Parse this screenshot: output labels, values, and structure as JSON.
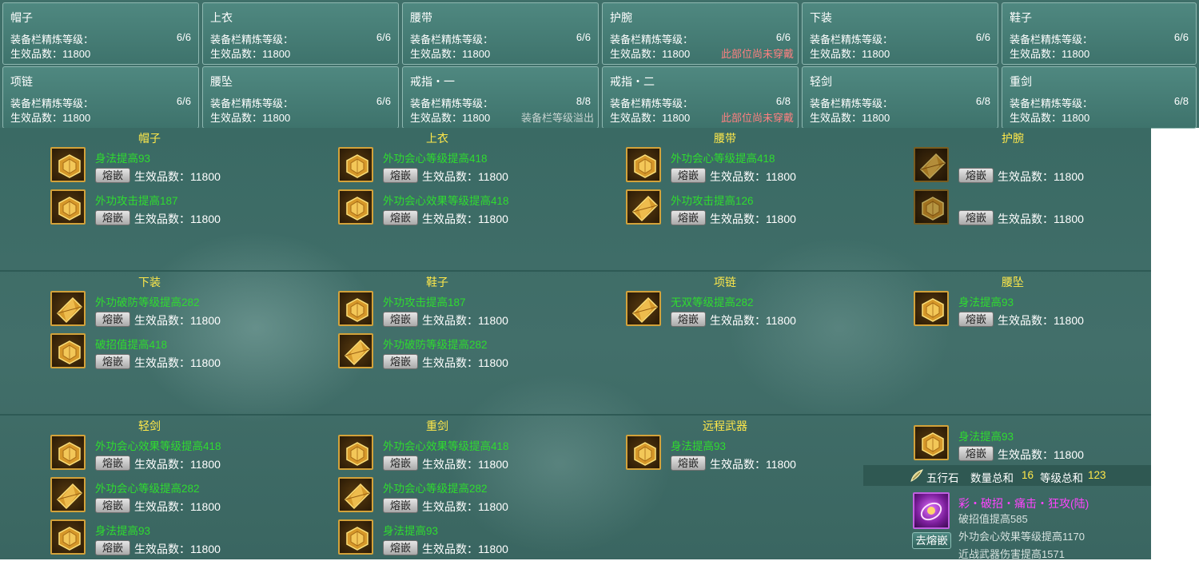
{
  "summary": {
    "refine_label": "装备栏精炼等级：",
    "count_label": "生效品数：11800",
    "cards": [
      {
        "name": "帽子",
        "level": "6/6",
        "note": "",
        "note_color": ""
      },
      {
        "name": "上衣",
        "level": "6/6",
        "note": "",
        "note_color": ""
      },
      {
        "name": "腰带",
        "level": "6/6",
        "note": "",
        "note_color": ""
      },
      {
        "name": "护腕",
        "level": "6/6",
        "note": "此部位尚未穿戴",
        "note_color": "#ff8080"
      },
      {
        "name": "下装",
        "level": "6/6",
        "note": "",
        "note_color": ""
      },
      {
        "name": "鞋子",
        "level": "6/6",
        "note": "",
        "note_color": ""
      },
      {
        "name": "项链",
        "level": "6/6",
        "note": "",
        "note_color": ""
      },
      {
        "name": "腰坠",
        "level": "6/6",
        "note": "",
        "note_color": ""
      },
      {
        "name": "戒指・一",
        "level": "8/8",
        "note": "装备栏等级溢出",
        "note_color": "#c7d3d0"
      },
      {
        "name": "戒指・二",
        "level": "6/8",
        "note": "此部位尚未穿戴",
        "note_color": "#ff8080"
      },
      {
        "name": "轻剑",
        "level": "6/8",
        "note": "",
        "note_color": ""
      },
      {
        "name": "重剑",
        "level": "6/8",
        "note": "",
        "note_color": ""
      }
    ]
  },
  "gems": {
    "melt_label": "熔嵌",
    "count_label": "生效品数：11800",
    "panels": [
      {
        "title": "帽子",
        "slots": [
          {
            "text": "身法提高93",
            "shape": "round"
          },
          {
            "text": "外功攻击提高187",
            "shape": "round"
          }
        ]
      },
      {
        "title": "上衣",
        "slots": [
          {
            "text": "外功会心等级提高418",
            "shape": "round"
          },
          {
            "text": "外功会心效果等级提高418",
            "shape": "round"
          }
        ]
      },
      {
        "title": "腰带",
        "slots": [
          {
            "text": "外功会心等级提高418",
            "shape": "round"
          },
          {
            "text": "外功攻击提高126",
            "shape": "diamond"
          }
        ]
      },
      {
        "title": "护腕",
        "slots": [
          {
            "text": "",
            "shape": "diamond",
            "dim": true
          },
          {
            "text": "",
            "shape": "round",
            "dim": true
          }
        ]
      },
      {
        "title": "下装",
        "slots": [
          {
            "text": "外功破防等级提高282",
            "shape": "diamond"
          },
          {
            "text": "破招值提高418",
            "shape": "round"
          }
        ]
      },
      {
        "title": "鞋子",
        "slots": [
          {
            "text": "外功攻击提高187",
            "shape": "round"
          },
          {
            "text": "外功破防等级提高282",
            "shape": "diamond"
          }
        ]
      },
      {
        "title": "项链",
        "slots": [
          {
            "text": "无双等级提高282",
            "shape": "diamond"
          }
        ]
      },
      {
        "title": "腰坠",
        "slots": [
          {
            "text": "身法提高93",
            "shape": "round"
          }
        ]
      },
      {
        "title": "轻剑",
        "slots": [
          {
            "text": "外功会心效果等级提高418",
            "shape": "round"
          },
          {
            "text": "外功会心等级提高282",
            "shape": "diamond"
          },
          {
            "text": "身法提高93",
            "shape": "round"
          }
        ]
      },
      {
        "title": "重剑",
        "slots": [
          {
            "text": "外功会心效果等级提高418",
            "shape": "round"
          },
          {
            "text": "外功会心等级提高282",
            "shape": "diamond"
          },
          {
            "text": "身法提高93",
            "shape": "round"
          }
        ]
      },
      {
        "title": "远程武器",
        "slots": [
          {
            "text": "身法提高93",
            "shape": "round"
          }
        ]
      },
      {
        "title": "",
        "slots": [
          {
            "text": "身法提高93",
            "shape": "round"
          }
        ]
      }
    ]
  },
  "wuxing": {
    "label": "五行石",
    "count_label": "数量总和",
    "count": "16",
    "level_label": "等级总和",
    "level": "123"
  },
  "colored_gem": {
    "name": "彩・破招・痛击・狂攻(陆)",
    "effects": [
      "破招值提高585",
      "外功会心效果等级提高1170",
      "近战武器伤害提高1571"
    ],
    "melt_label": "去熔嵌"
  },
  "colors": {
    "gem_text": "#2fdc2f",
    "panel_title": "#ffe84a",
    "warning": "#ff8080",
    "colored_gem_name": "#ff44ff"
  }
}
